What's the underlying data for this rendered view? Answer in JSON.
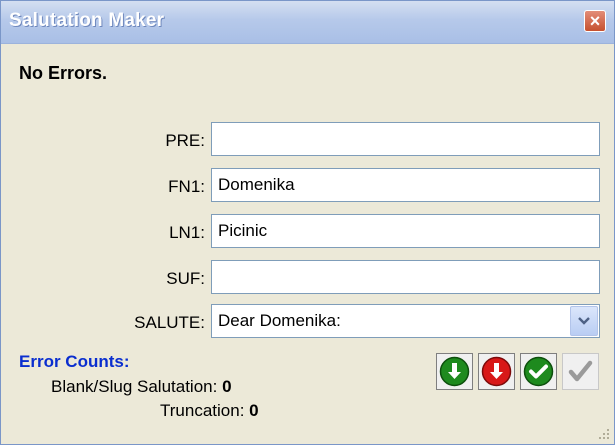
{
  "window": {
    "title": "Salutation Maker"
  },
  "status": {
    "message": "No Errors."
  },
  "fields": [
    {
      "label": "PRE:",
      "value": ""
    },
    {
      "label": "FN1:",
      "value": "Domenika"
    },
    {
      "label": "LN1:",
      "value": "Picinic"
    },
    {
      "label": "SUF:",
      "value": ""
    }
  ],
  "salute": {
    "label": "SALUTE:",
    "value": "Dear Domenika:"
  },
  "error_counts": {
    "title": "Error Counts:",
    "blank_slug": {
      "label": "Blank/Slug Salutation:",
      "value": "0"
    },
    "truncation": {
      "label": "Truncation:",
      "value": "0"
    }
  },
  "toolbar": {
    "buttons": [
      {
        "icon": "arrow-down-icon",
        "color": "#1e8a1e"
      },
      {
        "icon": "arrow-down-icon",
        "color": "#d81818"
      },
      {
        "icon": "check-icon",
        "color": "#1e8a1e"
      },
      {
        "icon": "check-icon",
        "color": "#9a9a9a"
      }
    ]
  },
  "colors": {
    "error_title": "#0a2ecf",
    "title_bar": "#b6c9ea",
    "window_bg": "#ece9d8"
  }
}
